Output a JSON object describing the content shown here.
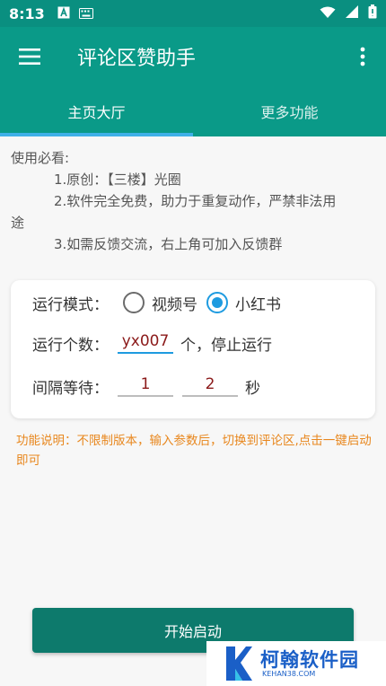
{
  "status_bar": {
    "time": "8:13"
  },
  "app_bar": {
    "title": "评论区赞助手"
  },
  "tabs": [
    {
      "label": "主页大厅"
    },
    {
      "label": "更多功能"
    }
  ],
  "notice": {
    "heading": "使用必看:",
    "line1": "1.原创：【三楼】光圈",
    "line2a": "2.软件完全免费，助力于重复动作，严禁非法用",
    "line2b": "途",
    "line3": "3.如需反馈交流，右上角可加入反馈群"
  },
  "settings": {
    "mode_label": "运行模式：",
    "mode_options": [
      {
        "label": "视频号",
        "checked": false
      },
      {
        "label": "小红书",
        "checked": true
      }
    ],
    "count_label": "运行个数：",
    "count_value": "yx007",
    "count_suffix": "个，停止运行",
    "interval_label": "间隔等待：",
    "interval_min": "1",
    "interval_max": "2",
    "interval_unit": "秒"
  },
  "description": "功能说明：不限制版本，输入参数后，切换到评论区,点击一键启动即可",
  "start_button": {
    "label": "开始启动"
  },
  "watermark": {
    "title": "柯翰软件园",
    "subtitle": "KEHAN38.COM"
  },
  "colors": {
    "primary": "#0a9a88",
    "accent": "#1e9be0",
    "button": "#0d7a6c",
    "warning": "#e8871e"
  }
}
